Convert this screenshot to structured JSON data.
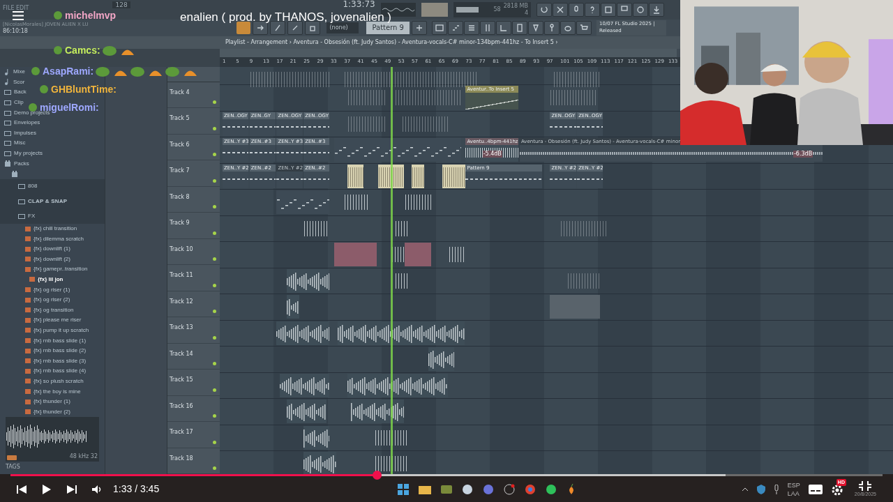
{
  "video": {
    "title": "enalien ( prod. by THANOS, jovenalien )",
    "time": "1:33 / 3:45",
    "progress": {
      "level": 0.42
    },
    "buffer": {
      "level": 0.82
    },
    "quality": "HD"
  },
  "chat": [
    {
      "user": "michelmvp",
      "color": "#f2a6c6"
    },
    {
      "user": "Camcs:",
      "color": "#c6ef5e"
    },
    {
      "user": "AsapRami:",
      "color": "#9ea8ff"
    },
    {
      "user": "GHBluntTime:",
      "color": "#f0b43c"
    },
    {
      "user": "miguelRomi:",
      "color": "#9ea8ff"
    }
  ],
  "fl": {
    "menu": "FILE EDIT",
    "tempo": "128",
    "clock": "1:33:73",
    "cpu": "58",
    "memory": "2818 MB",
    "polyphony": "4",
    "project": "[NicolasMorales] JOVEN ALIEN X LU",
    "project_time": "86:10:18",
    "snap": "(none)",
    "pattern": "Pattern 9",
    "news_date": "10/07",
    "news_title": "FL Studio 2025 |",
    "news_sub": "Released",
    "breadcrumb": "Playlist - Arrangement › Aventura - Obsesión (ft. Judy Santos) - Aventura-vocals-C# minor-134bpm-441hz - To Insert 5 ›"
  },
  "browser": [
    {
      "label": "Mixe",
      "kind": "mixer"
    },
    {
      "label": "Scor",
      "kind": "score"
    },
    {
      "label": "Back",
      "kind": "folder"
    },
    {
      "label": "Clip",
      "kind": "folder"
    },
    {
      "label": "Demo projects",
      "kind": "folder"
    },
    {
      "label": "Envelopes",
      "kind": "folder"
    },
    {
      "label": "Impulses",
      "kind": "folder"
    },
    {
      "label": "Misc",
      "kind": "folder"
    },
    {
      "label": "My projects",
      "kind": "folder"
    },
    {
      "label": "Packs",
      "kind": "pack",
      "children": [
        {
          "kind": "pack",
          "children": [
            {
              "label": "808",
              "kind": "folder"
            },
            {
              "label": "CLAP & SNAP",
              "kind": "folder"
            },
            {
              "label": "FX",
              "kind": "folder",
              "children": [
                {
                  "label": "{fx} chill transition",
                  "kind": "file",
                  "selected": false
                },
                {
                  "label": "{fx} dilemma scratch",
                  "kind": "file",
                  "selected": false
                },
                {
                  "label": "{fx} downlift (1)",
                  "kind": "file",
                  "selected": false
                },
                {
                  "label": "{fx} downlift (2)",
                  "kind": "file",
                  "selected": false
                },
                {
                  "label": "{fx} gamepr..transition",
                  "kind": "file",
                  "selected": false
                },
                {
                  "label": "{fx} lil jon",
                  "kind": "file",
                  "selected": true
                },
                {
                  "label": "{fx} og riser (1)",
                  "kind": "file",
                  "selected": false
                },
                {
                  "label": "{fx} og riser (2)",
                  "kind": "file",
                  "selected": false
                },
                {
                  "label": "{fx} og transition",
                  "kind": "file",
                  "selected": false
                },
                {
                  "label": "{fx} please me riser",
                  "kind": "file",
                  "selected": false
                },
                {
                  "label": "{fx} pump it up scratch",
                  "kind": "file",
                  "selected": false
                },
                {
                  "label": "{fx} rnb bass slide (1)",
                  "kind": "file",
                  "selected": false
                },
                {
                  "label": "{fx} rnb bass slide (2)",
                  "kind": "file",
                  "selected": false
                },
                {
                  "label": "{fx} rnb bass slide (3)",
                  "kind": "file",
                  "selected": false
                },
                {
                  "label": "{fx} rnb bass slide (4)",
                  "kind": "file",
                  "selected": false
                },
                {
                  "label": "{fx} so plush scratch",
                  "kind": "file",
                  "selected": false
                },
                {
                  "label": "{fx} the boy is mine",
                  "kind": "file",
                  "selected": false
                },
                {
                  "label": "{fx} thunder (1)",
                  "kind": "file",
                  "selected": false
                },
                {
                  "label": "{fx} thunder (2)",
                  "kind": "file",
                  "selected": false
                }
              ]
            }
          ]
        }
      ]
    }
  ],
  "preview": {
    "format": "48 kHz 32",
    "tags": "TAGS"
  },
  "ruler": [
    "1",
    "5",
    "9",
    "13",
    "17",
    "21",
    "25",
    "29",
    "33",
    "37",
    "41",
    "45",
    "49",
    "53",
    "57",
    "61",
    "65",
    "69",
    "73",
    "77",
    "81",
    "85",
    "89",
    "93",
    "97",
    "101",
    "105",
    "109",
    "113",
    "117",
    "121",
    "125",
    "129",
    "133"
  ],
  "playhead": {
    "level": 0.254
  },
  "tracks": [
    {
      "name": "Track 4",
      "clips": [
        {
          "label": "Aventur..To Insert 5",
          "muted": false
        }
      ]
    },
    {
      "name": "Track 5",
      "clips": [
        {
          "label": "ZEN..OGY",
          "muted": false
        },
        {
          "label": "ZEN..GY",
          "muted": false
        },
        {
          "label": "ZEN..OGY",
          "muted": false
        },
        {
          "label": "ZEN..OGY",
          "muted": false
        },
        {
          "label": "ZEN..OGY",
          "muted": false
        },
        {
          "label": "ZEN..OGY",
          "muted": false
        }
      ]
    },
    {
      "name": "Track 6",
      "clips": [
        {
          "label": "ZEN..Y #3",
          "muted": false
        },
        {
          "label": "ZEN..#3",
          "muted": false
        },
        {
          "label": "ZEN..Y #3",
          "muted": false
        },
        {
          "label": "ZEN..#3",
          "muted": false
        },
        {
          "label": "Aventu..4bpm-441hz",
          "muted": false
        },
        {
          "label": "Aventura - Obsesión (ft. Judy Santos) - Aventura-vocals-C# minor",
          "muted": true
        }
      ],
      "gains": [
        "-5.4dB",
        "-6.3dB"
      ]
    },
    {
      "name": "Track 7",
      "clips": [
        {
          "label": "ZEN..Y #2",
          "muted": false
        },
        {
          "label": "ZEN..#2",
          "muted": false
        },
        {
          "label": "ZEN..Y #2",
          "muted": true
        },
        {
          "label": "ZEN..#2",
          "muted": false
        },
        {
          "label": "Pattern 9",
          "muted": false
        },
        {
          "label": "ZEN..Y #2",
          "muted": false
        },
        {
          "label": "ZEN..Y #2",
          "muted": false
        }
      ]
    },
    {
      "name": "Track 8"
    },
    {
      "name": "Track 9"
    },
    {
      "name": "Track 10"
    },
    {
      "name": "Track 11"
    },
    {
      "name": "Track 12"
    },
    {
      "name": "Track 13"
    },
    {
      "name": "Track 14"
    },
    {
      "name": "Track 15"
    },
    {
      "name": "Track 16"
    },
    {
      "name": "Track 17"
    },
    {
      "name": "Track 18"
    }
  ],
  "tray": {
    "language": "ESP",
    "layout": "LAA",
    "date": "20/8/2025"
  }
}
